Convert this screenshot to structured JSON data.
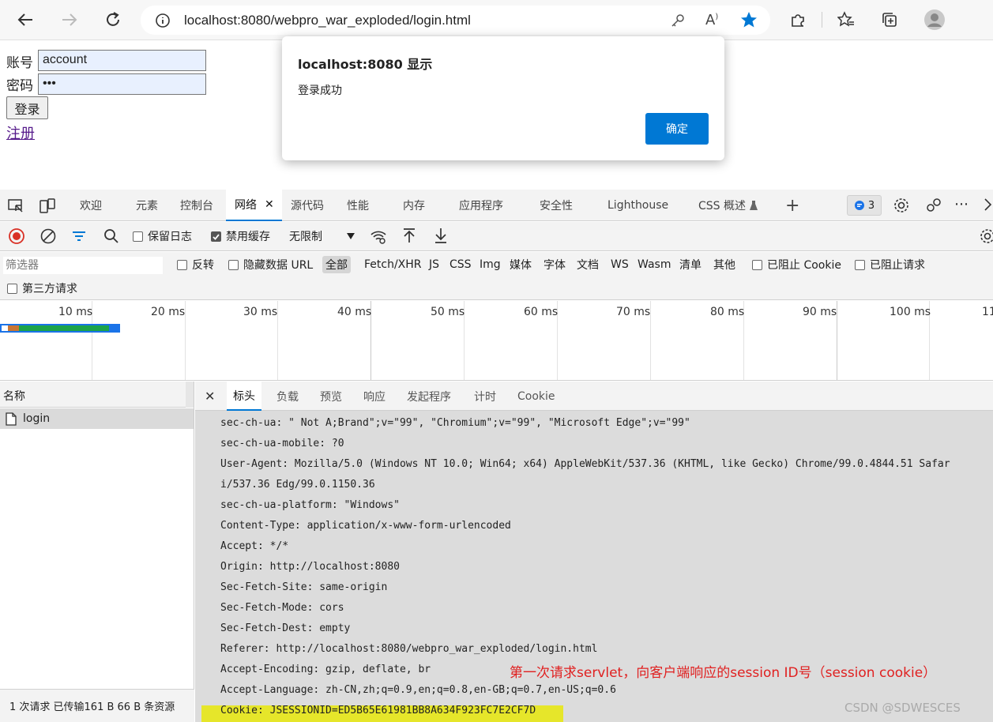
{
  "browser": {
    "url": "localhost:8080/webpro_war_exploded/login.html"
  },
  "page": {
    "account_label": "账号",
    "account_value": "account",
    "password_label": "密码",
    "password_value": "•••",
    "login_button": "登录",
    "register_link": "注册"
  },
  "alert": {
    "title": "localhost:8080 显示",
    "message": "登录成功",
    "ok_label": "确定"
  },
  "devtools": {
    "tabs": [
      "欢迎",
      "元素",
      "控制台",
      "网络",
      "源代码",
      "性能",
      "内存",
      "应用程序",
      "安全性",
      "Lighthouse",
      "CSS 概述"
    ],
    "active_tab": "网络",
    "issues_count": "3"
  },
  "network_bar": {
    "preserve_log": "保留日志",
    "disable_cache": "禁用缓存",
    "throttle": "无限制"
  },
  "filter_bar": {
    "filter_placeholder": "筛选器",
    "invert": "反转",
    "hide_data_urls": "隐藏数据 URL",
    "types": [
      "全部",
      "Fetch/XHR",
      "JS",
      "CSS",
      "Img",
      "媒体",
      "字体",
      "文档",
      "WS",
      "Wasm",
      "清单",
      "其他"
    ],
    "blocked_cookies": "已阻止 Cookie",
    "blocked_requests": "已阻止请求",
    "third_party": "第三方请求"
  },
  "overview": {
    "ticks": [
      "10 ms",
      "20 ms",
      "30 ms",
      "40 ms",
      "50 ms",
      "60 ms",
      "70 ms",
      "80 ms",
      "90 ms",
      "100 ms",
      "11"
    ]
  },
  "requests": {
    "name_header": "名称",
    "rows": [
      "login"
    ],
    "status": "1 次请求  已传输161 B  66 B 条资源"
  },
  "detail": {
    "tabs": [
      "标头",
      "负载",
      "预览",
      "响应",
      "发起程序",
      "计时",
      "Cookie"
    ],
    "headers": [
      "sec-ch-ua: \" Not A;Brand\";v=\"99\", \"Chromium\";v=\"99\", \"Microsoft Edge\";v=\"99\"",
      "sec-ch-ua-mobile: ?0",
      "User-Agent: Mozilla/5.0 (Windows NT 10.0; Win64; x64) AppleWebKit/537.36 (KHTML, like Gecko) Chrome/99.0.4844.51 Safar",
      "i/537.36 Edg/99.0.1150.36",
      "sec-ch-ua-platform: \"Windows\"",
      "Content-Type: application/x-www-form-urlencoded",
      "Accept: */*",
      "Origin: http://localhost:8080",
      "Sec-Fetch-Site: same-origin",
      "Sec-Fetch-Mode: cors",
      "Sec-Fetch-Dest: empty",
      "Referer: http://localhost:8080/webpro_war_exploded/login.html",
      "Accept-Encoding: gzip, deflate, br",
      "Accept-Language: zh-CN,zh;q=0.9,en;q=0.8,en-GB;q=0.7,en-US;q=0.6",
      "Cookie: JSESSIONID=ED5B65E61981BB8A634F923FC7E2CF7D"
    ],
    "annotation": "第一次请求servlet，向客户端响应的session ID号（session cookie）",
    "watermark": "CSDN @SDWESCES"
  },
  "colors": {
    "accent": "#0078d4",
    "annotation": "#e02020",
    "highlight": "#e6e62a"
  }
}
